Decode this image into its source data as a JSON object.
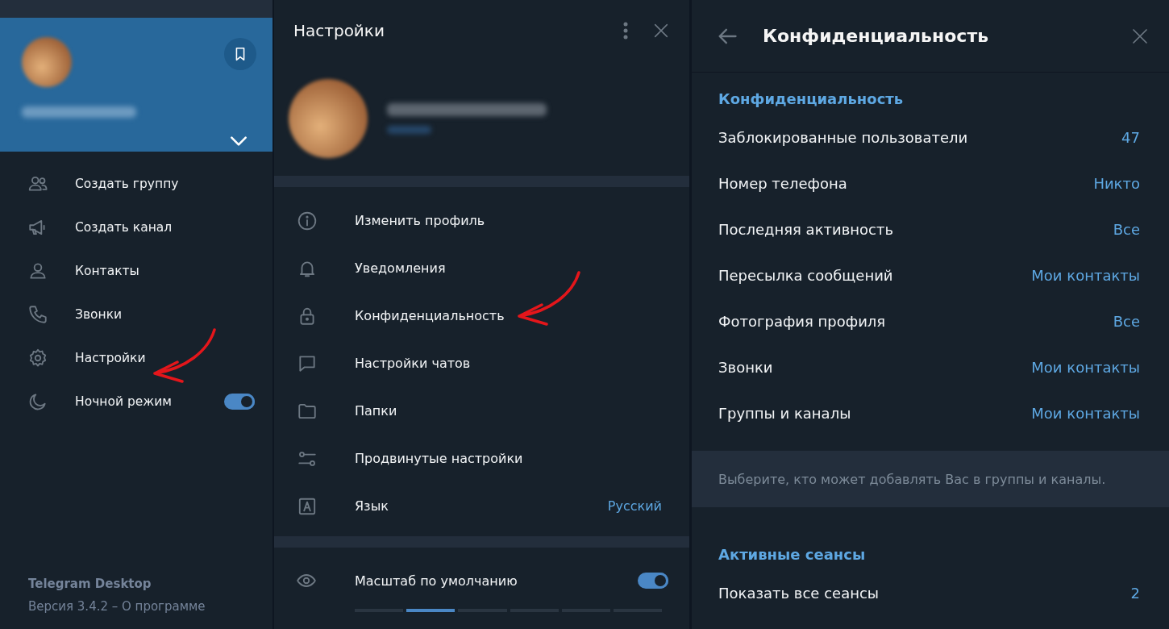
{
  "sidebar": {
    "menu": [
      {
        "kind": "link",
        "label": "Создать группу",
        "marked": false
      },
      {
        "kind": "link",
        "label": "Создать канал",
        "marked": false
      },
      {
        "kind": "link",
        "label": "Контакты",
        "marked": false
      },
      {
        "kind": "link",
        "label": "Звонки",
        "marked": false
      },
      {
        "kind": "link",
        "label": "Настройки",
        "marked": true
      },
      {
        "kind": "toggle",
        "label": "Ночной режим",
        "on": true,
        "marked": false
      }
    ],
    "footer": {
      "app": "Telegram Desktop",
      "version": "Версия 3.4.2 – О программе"
    }
  },
  "settings": {
    "title": "Настройки",
    "items": [
      {
        "label": "Изменить профиль",
        "marked": false
      },
      {
        "label": "Уведомления",
        "marked": false
      },
      {
        "label": "Конфиденциальность",
        "marked": true
      },
      {
        "label": "Настройки чатов",
        "marked": false
      },
      {
        "label": "Папки",
        "marked": false
      },
      {
        "label": "Продвинутые настройки",
        "marked": false
      },
      {
        "label": "Язык",
        "value": "Русский",
        "marked": false
      }
    ],
    "scale": {
      "label": "Масштаб по умолчанию",
      "on": true,
      "steps": [
        {
          "selected": false
        },
        {
          "selected": true
        },
        {
          "selected": false
        },
        {
          "selected": false
        },
        {
          "selected": false
        },
        {
          "selected": false
        }
      ]
    }
  },
  "privacy": {
    "title": "Конфиденциальность",
    "sections": [
      {
        "heading": "Конфиденциальность",
        "rows": [
          {
            "label": "Заблокированные пользователи",
            "value": "47"
          },
          {
            "label": "Номер телефона",
            "value": "Никто"
          },
          {
            "label": "Последняя активность",
            "value": "Все"
          },
          {
            "label": "Пересылка сообщений",
            "value": "Мои контакты"
          },
          {
            "label": "Фотография профиля",
            "value": "Все"
          },
          {
            "label": "Звонки",
            "value": "Мои контакты"
          },
          {
            "label": "Группы и каналы",
            "value": "Мои контакты"
          }
        ],
        "note": "Выберите, кто может добавлять Вас в группы и каналы."
      },
      {
        "heading": "Активные сеансы",
        "rows": [
          {
            "label": "Показать все сеансы",
            "value": "2"
          }
        ]
      }
    ]
  }
}
